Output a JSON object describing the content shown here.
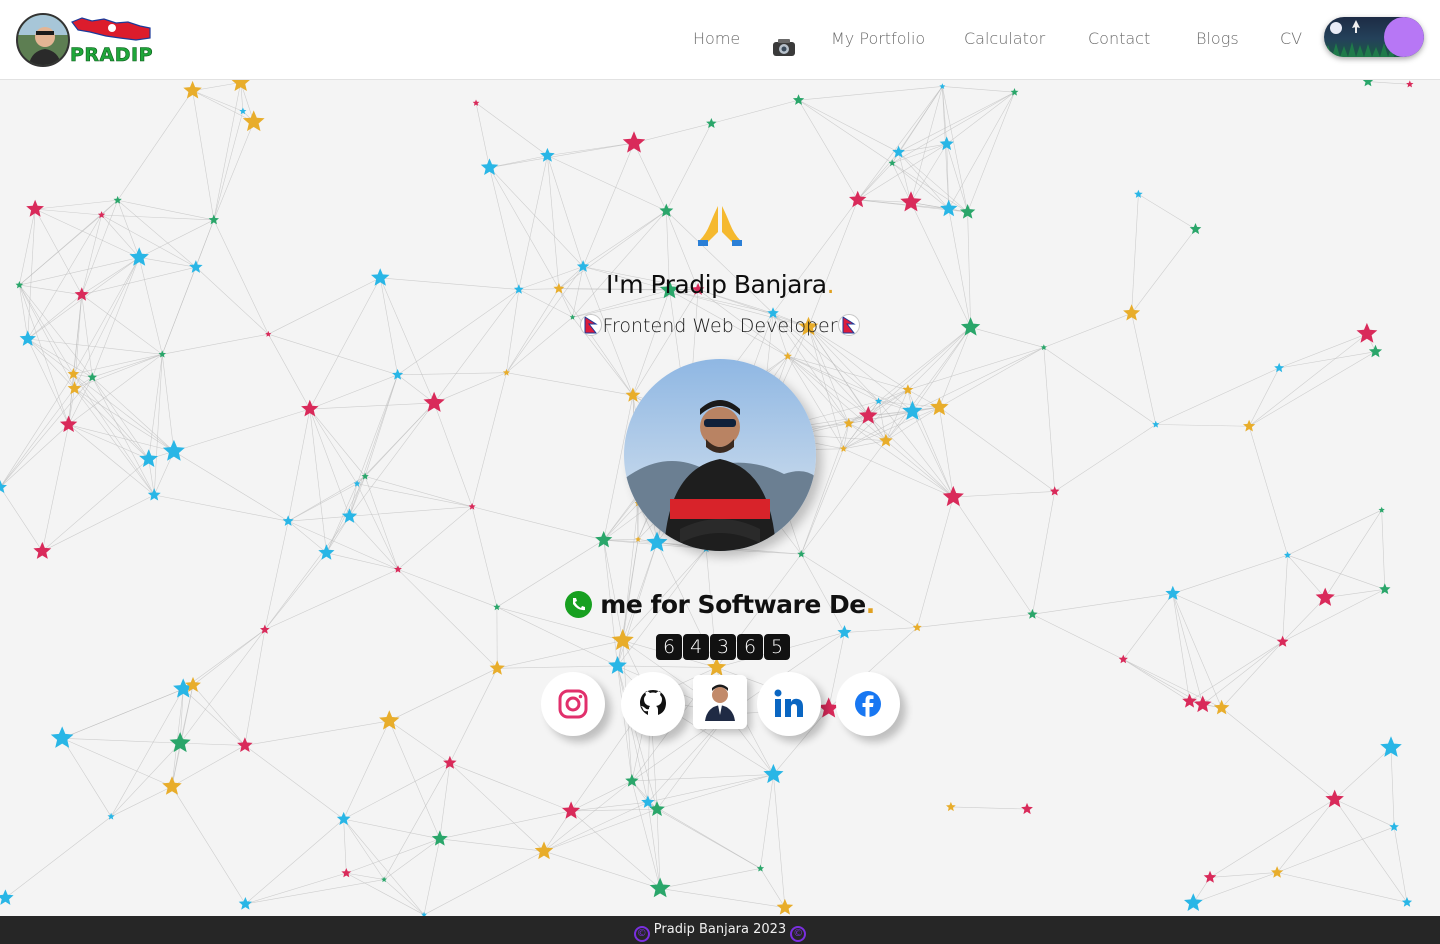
{
  "header": {
    "logo_text": "PRADIP",
    "nav": [
      {
        "label": "Home"
      },
      {
        "label": "My Portfolio"
      },
      {
        "label": "Calculator"
      },
      {
        "label": "Contact"
      },
      {
        "label": "Blogs"
      },
      {
        "label": "CV"
      }
    ],
    "theme_toggle": {
      "state": "dark",
      "icon": "moon-rocket-icon"
    }
  },
  "hero": {
    "emoji": "🙏",
    "name": "I'm Pradip Banjara",
    "name_suffix": ".",
    "role": "Frontend Web Developer",
    "typed_text": "me for Software De",
    "typed_cursor": ".",
    "counter_digits": [
      "6",
      "4",
      "3",
      "6",
      "5"
    ]
  },
  "socials": [
    {
      "name": "instagram",
      "icon": "instagram-icon"
    },
    {
      "name": "github",
      "icon": "github-icon"
    },
    {
      "name": "profile",
      "icon": "profile-photo-icon"
    },
    {
      "name": "linkedin",
      "icon": "linkedin-icon"
    },
    {
      "name": "facebook",
      "icon": "facebook-icon"
    }
  ],
  "footer": {
    "text": "Pradip Banjara 2023"
  },
  "colors": {
    "star_blue": "#29b6e6",
    "star_green": "#2aa66a",
    "star_red": "#d92a5a",
    "star_gold": "#e8ad2b",
    "toggle_knob": "#b777f5",
    "footer_bg": "#262626"
  }
}
